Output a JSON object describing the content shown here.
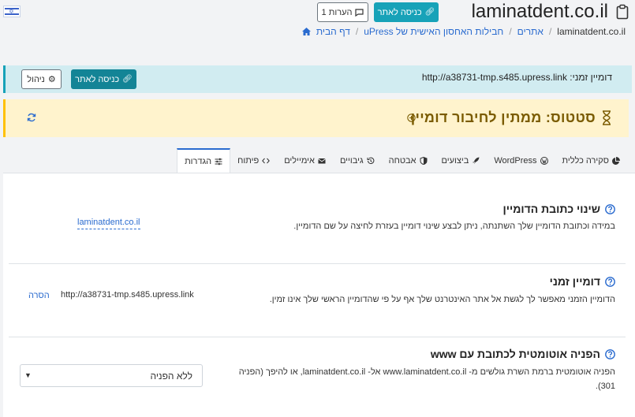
{
  "header": {
    "site_title": "laminatdent.co.il",
    "enter_site_label": "כניסה לאתר",
    "notes_label": "1 הערות"
  },
  "breadcrumb": {
    "home": "דף הבית",
    "backup": "חבילות האחסון האישית של uPress",
    "sites": "אתרים",
    "current": "laminatdent.co.il"
  },
  "infobar": {
    "temp_domain_text": "דומיין זמני: http://a38731-tmp.s485.upress.link",
    "enter_site_label": "כניסה לאתר",
    "manage_label": "ניהול"
  },
  "status": {
    "text": "סטטוס: ממתין לחיבור דומיין"
  },
  "tabs": [
    {
      "label": "סקירה כללית",
      "icon": "pie-chart-icon"
    },
    {
      "label": "WordPress",
      "icon": "wordpress-icon"
    },
    {
      "label": "ביצועים",
      "icon": "rocket-icon"
    },
    {
      "label": "אבטחה",
      "icon": "shield-icon"
    },
    {
      "label": "גיבויים",
      "icon": "history-icon"
    },
    {
      "label": "אימיילים",
      "icon": "envelope-icon"
    },
    {
      "label": "פיתוח",
      "icon": "code-icon"
    },
    {
      "label": "הגדרות",
      "icon": "sliders-icon"
    }
  ],
  "sections": {
    "domain_change": {
      "title": "שינוי כתובת הדומיין",
      "desc": "במידה וכתובת הדומיין שלך השתנתה, ניתן לבצע שינוי דומיין בעזרת לחיצה על שם הדומיין.",
      "domain_link": "laminatdent.co.il"
    },
    "temp_domain": {
      "title": "דומיין זמני",
      "desc": "הדומיין הזמני מאפשר לך לגשת אל אתר האינטרנט שלך אף על פי שהדומיין הראשי שלך אינו זמין.",
      "value": "http://a38731-tmp.s485.upress.link",
      "remove_label": "הסרה"
    },
    "www_redirect": {
      "title": "הפניה אוטומטית לכתובת עם www",
      "desc_line1": "הפניה אוטומטית ברמת השרת גולשים מ- www.laminatdent.co.il אל- laminatdent.co.il, או להיפך (הפניה",
      "desc_line2": "301).",
      "select_value": "ללא הפניה"
    }
  },
  "colors": {
    "teal": "#17a2b8",
    "info_bg": "#d1ecf1",
    "warning_bg": "#fff3cd",
    "link": "#2a6bcf"
  }
}
